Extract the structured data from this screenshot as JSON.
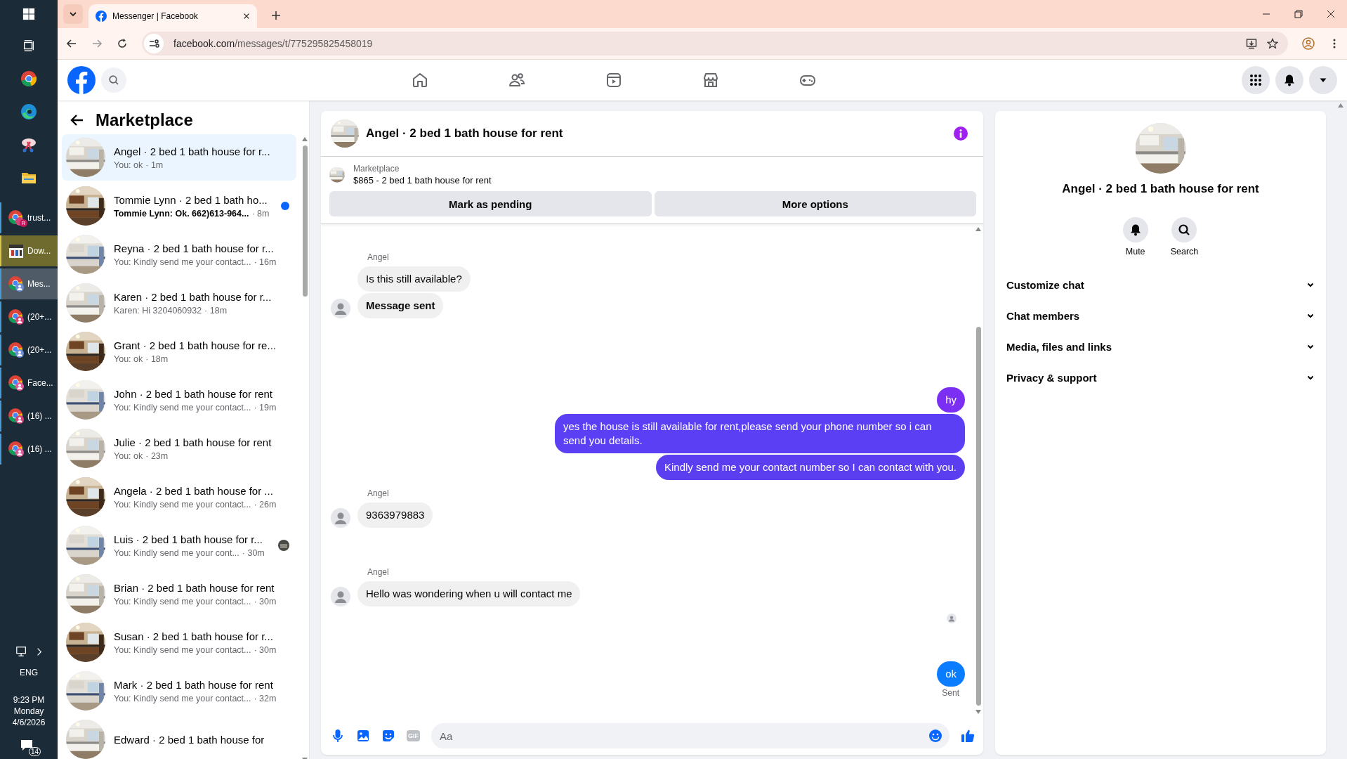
{
  "taskbar": {
    "windows": [
      {
        "label": "trust...",
        "kind": "chrome",
        "selected": false,
        "flashing": false,
        "badge": "R"
      },
      {
        "label": "Dow...",
        "kind": "media",
        "selected": false,
        "flashing": true
      },
      {
        "label": "Mes...",
        "kind": "chrome",
        "selected": true,
        "flashing": false
      },
      {
        "label": "(20+...",
        "kind": "chrome",
        "selected": false,
        "flashing": false
      },
      {
        "label": "(20+...",
        "kind": "chrome",
        "selected": false,
        "flashing": false
      },
      {
        "label": "Face...",
        "kind": "chrome",
        "selected": false,
        "flashing": false
      },
      {
        "label": "(16) ...",
        "kind": "chrome",
        "selected": false,
        "flashing": false
      },
      {
        "label": "(16) ...",
        "kind": "chrome",
        "selected": false,
        "flashing": false
      }
    ],
    "language": "ENG",
    "time": "9:23 PM",
    "day": "Monday",
    "date": "4/6/2026",
    "notifications": "14"
  },
  "browser": {
    "tab_title": "Messenger | Facebook",
    "url_host": "facebook.com",
    "url_path": "/messages/t/775295825458019"
  },
  "sidebar": {
    "title": "Marketplace",
    "conversations": [
      {
        "title": "Angel · 2 bed 1 bath house for r...",
        "preview": "You: ok",
        "time": "· 1m",
        "selected": true,
        "unread": false,
        "seen": false
      },
      {
        "title": "Tommie Lynn · 2 bed 1 bath ho...",
        "preview": "Tommie Lynn: Ok. 662)613-964...",
        "time": "· 8m",
        "selected": false,
        "unread": true,
        "seen": false
      },
      {
        "title": "Reyna · 2 bed 1 bath house for r...",
        "preview": "You: Kindly send me your contact...",
        "time": "· 16m",
        "selected": false,
        "unread": false,
        "seen": false
      },
      {
        "title": "Karen · 2 bed 1 bath house for r...",
        "preview": "Karen: Hi 3204060932",
        "time": "· 18m",
        "selected": false,
        "unread": false,
        "seen": false
      },
      {
        "title": "Grant · 2 bed 1 bath house for re...",
        "preview": "You: ok",
        "time": "· 18m",
        "selected": false,
        "unread": false,
        "seen": false
      },
      {
        "title": "John · 2 bed 1 bath house for rent",
        "preview": "You: Kindly send me your contact...",
        "time": "· 19m",
        "selected": false,
        "unread": false,
        "seen": false
      },
      {
        "title": "Julie · 2 bed 1 bath house for rent",
        "preview": "You: ok",
        "time": "· 23m",
        "selected": false,
        "unread": false,
        "seen": false
      },
      {
        "title": "Angela · 2 bed 1 bath house for ...",
        "preview": "You: Kindly send me your contact...",
        "time": "· 26m",
        "selected": false,
        "unread": false,
        "seen": false
      },
      {
        "title": "Luis · 2 bed 1 bath house for r...",
        "preview": "You: Kindly send me your cont...",
        "time": "· 30m",
        "selected": false,
        "unread": false,
        "seen": true
      },
      {
        "title": "Brian · 2 bed 1 bath house for rent",
        "preview": "You: Kindly send me your contact...",
        "time": "· 30m",
        "selected": false,
        "unread": false,
        "seen": false
      },
      {
        "title": "Susan · 2 bed 1 bath house for r...",
        "preview": "You: Kindly send me your contact...",
        "time": "· 30m",
        "selected": false,
        "unread": false,
        "seen": false
      },
      {
        "title": "Mark · 2 bed 1 bath house for rent",
        "preview": "You: Kindly send me your contact...",
        "time": "· 32m",
        "selected": false,
        "unread": false,
        "seen": false
      },
      {
        "title": "Edward · 2 bed 1 bath house for",
        "selected": false,
        "unread": false,
        "seen": false
      }
    ]
  },
  "chat": {
    "title": "Angel · 2 bed 1 bath house for rent",
    "listing_label": "Marketplace",
    "listing": "$865 - 2 bed 1 bath house for rent",
    "actions": [
      "Mark as pending",
      "More options"
    ],
    "messages": [
      {
        "kind": "sender",
        "text": "Angel"
      },
      {
        "kind": "incoming",
        "text": "Is this still available?",
        "avatar": false,
        "bold": false
      },
      {
        "kind": "incoming",
        "text": "Message sent",
        "avatar": true,
        "bold": true
      },
      {
        "kind": "outgoing",
        "text": "hy",
        "color": "#7a2ff2"
      },
      {
        "kind": "outgoing",
        "text": "yes the house is still available for rent,please send your phone number so i can send you details.",
        "color": "#5b3ff5"
      },
      {
        "kind": "outgoing",
        "text": "Kindly send me your contact number so I can contact with you.",
        "color": "#5a3ef0"
      },
      {
        "kind": "sender",
        "text": "Angel"
      },
      {
        "kind": "incoming",
        "text": "9363979883",
        "avatar": true,
        "bold": false
      },
      {
        "kind": "sender",
        "text": "Angel"
      },
      {
        "kind": "incoming",
        "text": "Hello was wondering when u will contact me",
        "avatar": true,
        "bold": false
      },
      {
        "kind": "seen"
      },
      {
        "kind": "outgoing",
        "text": "ok",
        "color": "#0a7cff"
      },
      {
        "kind": "status",
        "text": "Sent"
      }
    ],
    "gif_label": "GIF",
    "placeholder": "Aa"
  },
  "details": {
    "title": "Angel · 2 bed 1 bath house for rent",
    "actions": [
      "Mute",
      "Search"
    ],
    "sections": [
      "Customize chat",
      "Chat members",
      "Media, files and links",
      "Privacy & support"
    ]
  }
}
